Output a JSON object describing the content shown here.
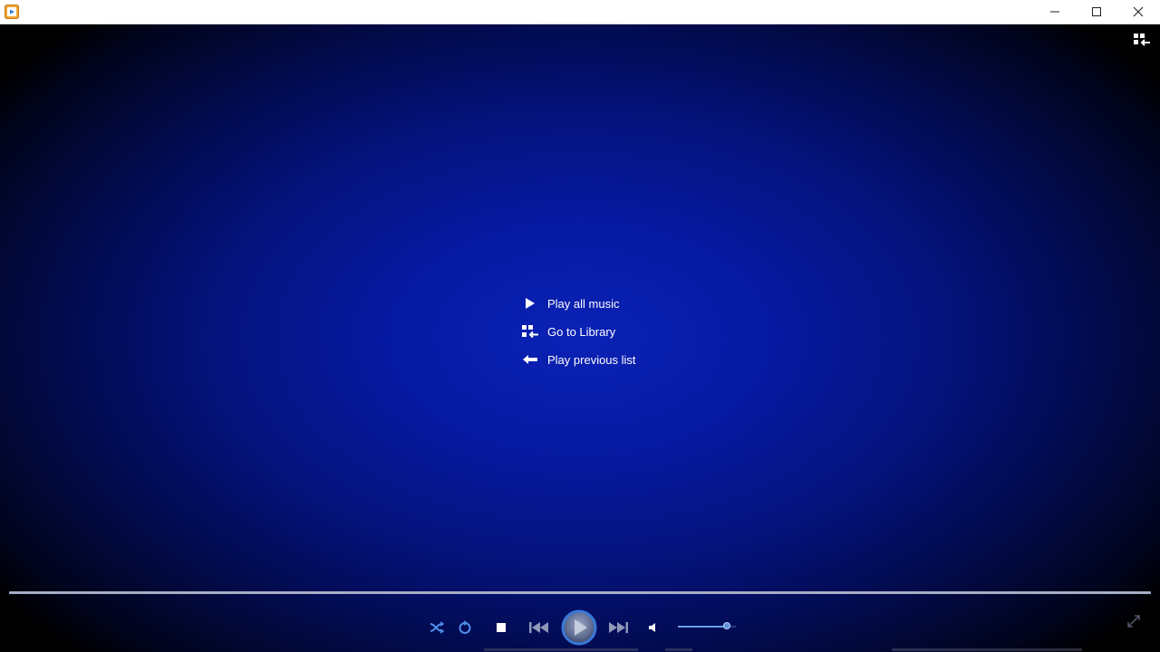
{
  "window": {
    "icon": "media-player-icon",
    "controls": [
      "minimize-icon",
      "maximize-icon",
      "close-icon"
    ]
  },
  "corner_button": {
    "icon": "library-switch-icon"
  },
  "menu": {
    "items": [
      {
        "icon": "play-icon",
        "label": "Play all music"
      },
      {
        "icon": "library-icon",
        "label": "Go to Library"
      },
      {
        "icon": "back-arrow-icon",
        "label": "Play previous list"
      }
    ]
  },
  "seek": {
    "position": 0
  },
  "transport": {
    "buttons": [
      "shuffle-icon",
      "repeat-icon",
      "stop-icon",
      "previous-icon",
      "play-icon",
      "next-icon",
      "volume-icon"
    ],
    "volume": 0.85
  },
  "fullscreen_button": {
    "icon": "fullscreen-icon"
  },
  "colors": {
    "accent": "#3a78d8",
    "background_center": "#0a22b6",
    "background_edge": "#000000",
    "text": "#ffffff"
  }
}
